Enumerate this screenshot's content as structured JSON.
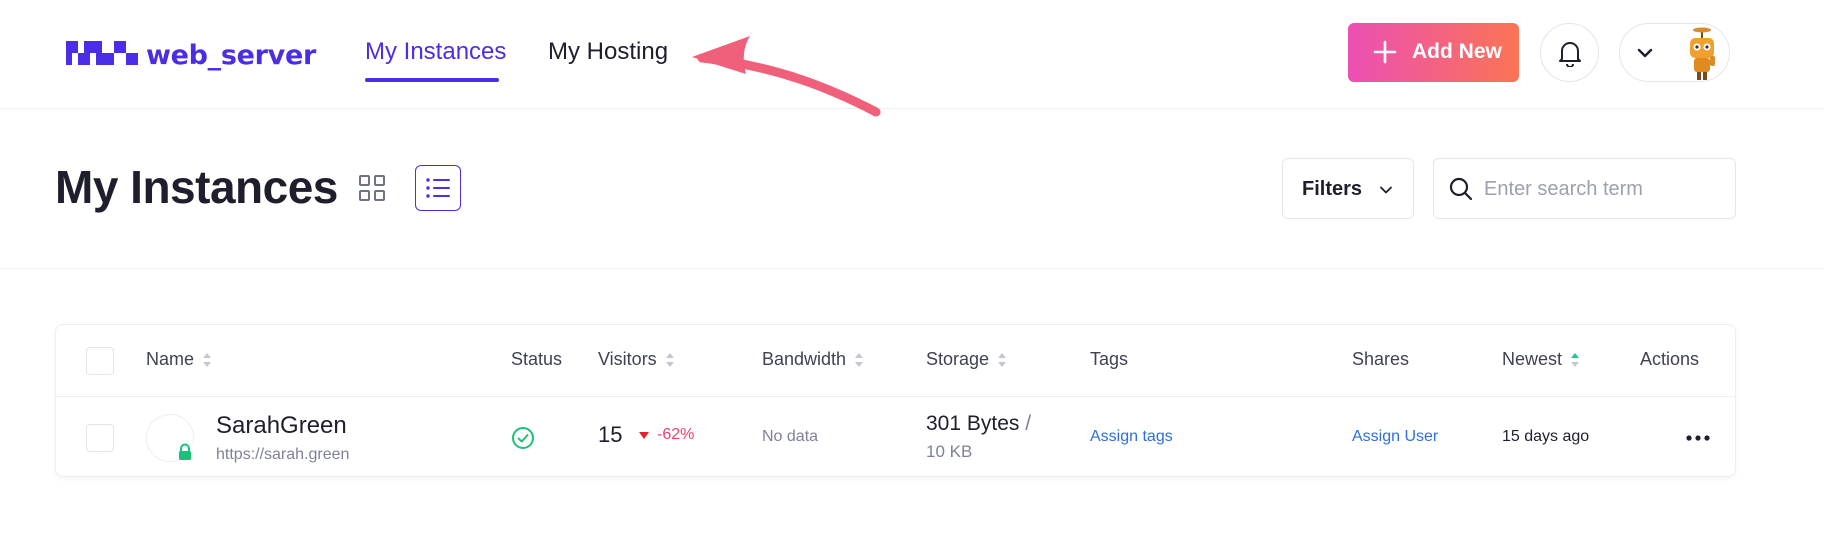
{
  "brand": {
    "name": "web_server",
    "accent": "#4a2ee6"
  },
  "nav": {
    "items": [
      {
        "label": "My Instances",
        "active": true
      },
      {
        "label": "My Hosting",
        "active": false
      }
    ]
  },
  "actions": {
    "add_new_label": "Add New",
    "add_gradient": [
      "#ec4fb4",
      "#fb7454"
    ]
  },
  "icons": {
    "bell": "bell-icon",
    "avatar": "robot-avatar",
    "search": "search-icon"
  },
  "page": {
    "title": "My Instances",
    "view_modes": [
      "grid",
      "list"
    ],
    "active_view": "list",
    "filters_label": "Filters",
    "search_placeholder": "Enter search term",
    "search_value": ""
  },
  "table": {
    "columns": {
      "name": "Name",
      "status": "Status",
      "visitors": "Visitors",
      "bandwidth": "Bandwidth",
      "storage": "Storage",
      "tags": "Tags",
      "shares": "Shares",
      "newest": "Newest",
      "actions": "Actions"
    },
    "rows": [
      {
        "name": "SarahGreen",
        "url": "https://sarah.green",
        "status": "online",
        "visitors": "15",
        "visitors_change": "-62%",
        "bandwidth": "No data",
        "storage_used": "301 Bytes",
        "storage_sep": "/",
        "storage_total": "10 KB",
        "tags_link": "Assign tags",
        "shares_link": "Assign User",
        "newest": "15 days ago"
      }
    ]
  },
  "annotation": {
    "color": "#f0607a"
  }
}
